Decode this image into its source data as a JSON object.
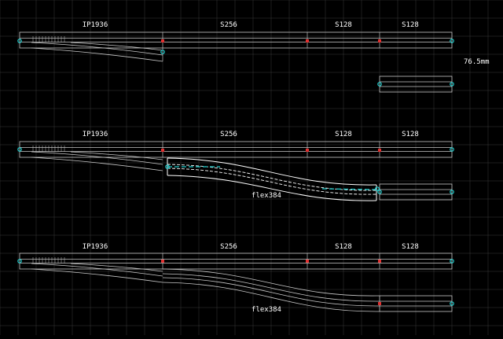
{
  "colors": {
    "background": "#000000",
    "grid": "#3a3a3a",
    "track": "#c8c8c8",
    "joint": "#e03030",
    "endpoint": "#20d0d0",
    "label": "#ffffff"
  },
  "offset_label": "76.5mm",
  "layouts": [
    {
      "labels": [
        "IP1936",
        "S256",
        "S128",
        "S128"
      ]
    },
    {
      "labels": [
        "IP1936",
        "S256",
        "S128",
        "S128"
      ],
      "flex_label": "flex384"
    },
    {
      "labels": [
        "IP1936",
        "S256",
        "S128",
        "S128"
      ],
      "flex_label": "flex384"
    }
  ]
}
